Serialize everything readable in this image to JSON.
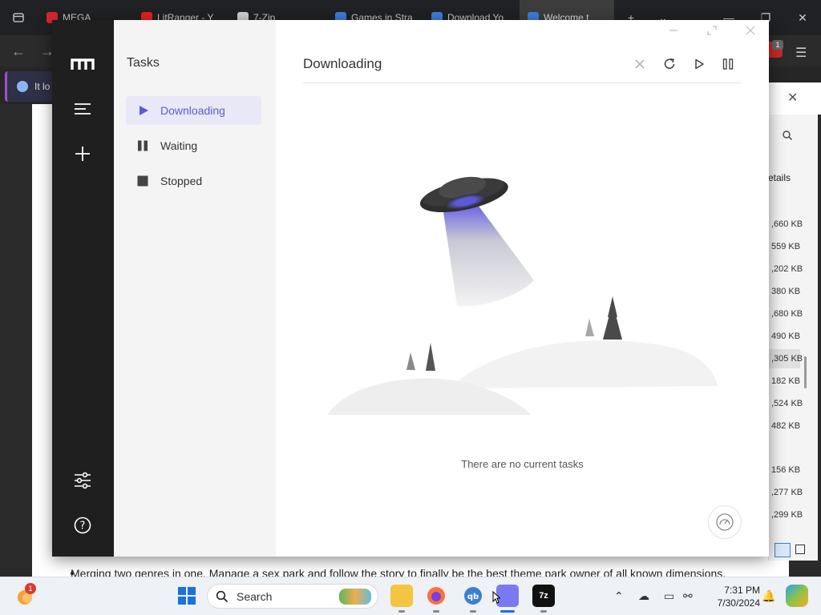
{
  "browser": {
    "tabs": [
      {
        "label": "MEGA",
        "color": "#d9272e",
        "active": false
      },
      {
        "label": "LitRanger - Y",
        "color": "#e62117",
        "active": false
      },
      {
        "label": "7-Zip",
        "color": "#cfcfcf",
        "active": false
      },
      {
        "label": "Games in Stra",
        "color": "#3d7dd8",
        "active": false
      },
      {
        "label": "Download Yo",
        "color": "#3d7dd8",
        "active": false
      },
      {
        "label": "Welcome t",
        "color": "#3d7dd8",
        "active": true
      }
    ],
    "infobar_text": "It lo",
    "ext_badge": "1",
    "page_text": "Merging two genres in one. Manage a sex park and follow the story to finally be the best theme park owner of all known dimensions."
  },
  "sevenzip": {
    "details_label": "etails",
    "sizes": [
      ",660 KB",
      "559 KB",
      ",202 KB",
      "380 KB",
      ",680 KB",
      "490 KB",
      ",305 KB",
      "182 KB",
      ",524 KB",
      "482 KB",
      "156 KB",
      ",277 KB",
      ",299 KB"
    ]
  },
  "app": {
    "sidebar_title": "Tasks",
    "nav": [
      {
        "label": "Downloading",
        "icon": "play-icon",
        "selected": true
      },
      {
        "label": "Waiting",
        "icon": "pause-icon",
        "selected": false
      },
      {
        "label": "Stopped",
        "icon": "stop-icon",
        "selected": false
      }
    ],
    "main_title": "Downloading",
    "empty_text": "There are no current tasks",
    "accent_color": "#5b5bd6"
  },
  "taskbar": {
    "search_placeholder": "Search",
    "weather_badge": "1",
    "time": "7:31 PM",
    "date": "7/30/2024"
  }
}
